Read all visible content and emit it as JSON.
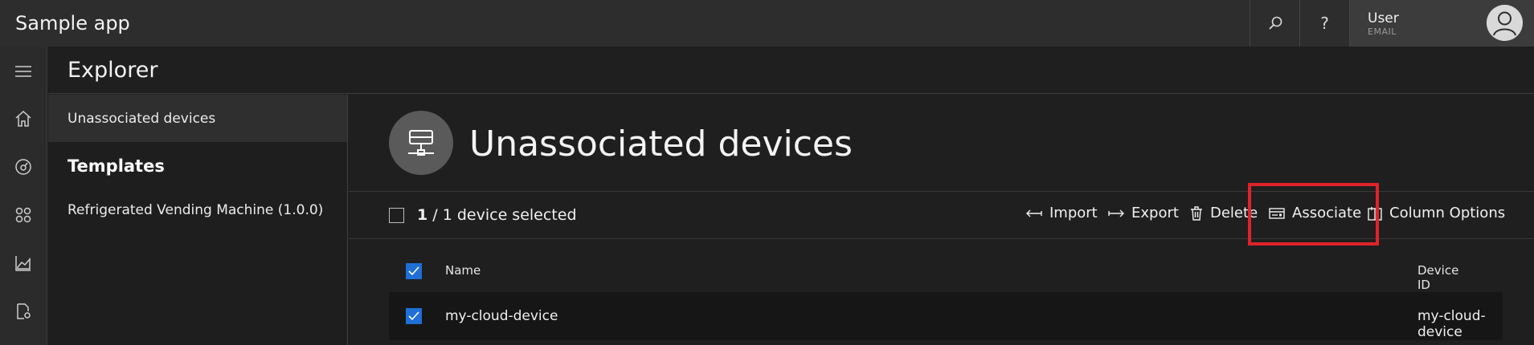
{
  "app": {
    "title": "Sample app"
  },
  "header": {
    "search_icon": "search-icon",
    "help_label": "?",
    "user": {
      "name": "User",
      "email": "EMAIL"
    }
  },
  "nav": {
    "icons": [
      "hamburger-icon",
      "home-icon",
      "dashboard-icon",
      "apps-icon",
      "analytics-icon",
      "jobs-icon"
    ]
  },
  "explorer": {
    "title": "Explorer",
    "side": {
      "active_item": "Unassociated devices",
      "templates_heading": "Templates",
      "template_item": "Refrigerated Vending Machine (1.0.0)"
    }
  },
  "main": {
    "title": "Unassociated devices",
    "selection": {
      "count": "1",
      "total": "/ 1 device selected"
    },
    "commands": {
      "import": "Import",
      "export": "Export",
      "delete": "Delete",
      "associate": "Associate",
      "column_options": "Column Options"
    },
    "table": {
      "columns": [
        "Name",
        "Device ID"
      ],
      "rows": [
        {
          "name": "my-cloud-device",
          "device_id": "my-cloud-device",
          "checked": true
        }
      ]
    }
  },
  "colors": {
    "accent": "#1f6fd6",
    "highlight": "#e0232a"
  }
}
